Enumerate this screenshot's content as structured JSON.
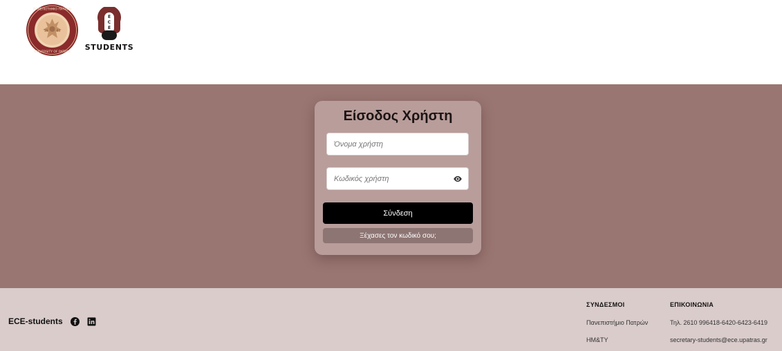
{
  "header": {
    "university_logo": {
      "icon": "university-of-patras-seal",
      "color": "#8b2a2a"
    },
    "ece_logo": {
      "icon": "ece-students-logo",
      "letters": "ECE",
      "text": "STUDENTS",
      "color": "#7a2e2e"
    }
  },
  "login": {
    "title": "Είσοδος Χρήστη",
    "username_placeholder": "Όνομα χρήστη",
    "password_placeholder": "Κωδικός χρήστη",
    "show_password_icon": "eye-icon",
    "login_button": "Σύνδεση",
    "forgot_button": "Ξέχασες τον κωδικό σου;"
  },
  "footer": {
    "brand": "ECE-students",
    "social": [
      {
        "icon": "facebook-icon"
      },
      {
        "icon": "linkedin-icon"
      }
    ],
    "links": {
      "title": "ΣΥΝΔΕΣΜΟΙ",
      "items": [
        "Πανεπιστήμιο Πατρών",
        "ΗΜ&ΤΥ"
      ]
    },
    "contact": {
      "title": "ΕΠΙΚΟΙΝΩΝΙΑ",
      "items": [
        "Τηλ. 2610 996418-6420-6423-6419",
        "secretary-students@ece.upatras.gr"
      ]
    }
  },
  "colors": {
    "hero_bg": "#9a7672",
    "card_bg": "#b89d9a",
    "footer_bg": "#d9cccb",
    "accent": "#7a2e2e"
  }
}
